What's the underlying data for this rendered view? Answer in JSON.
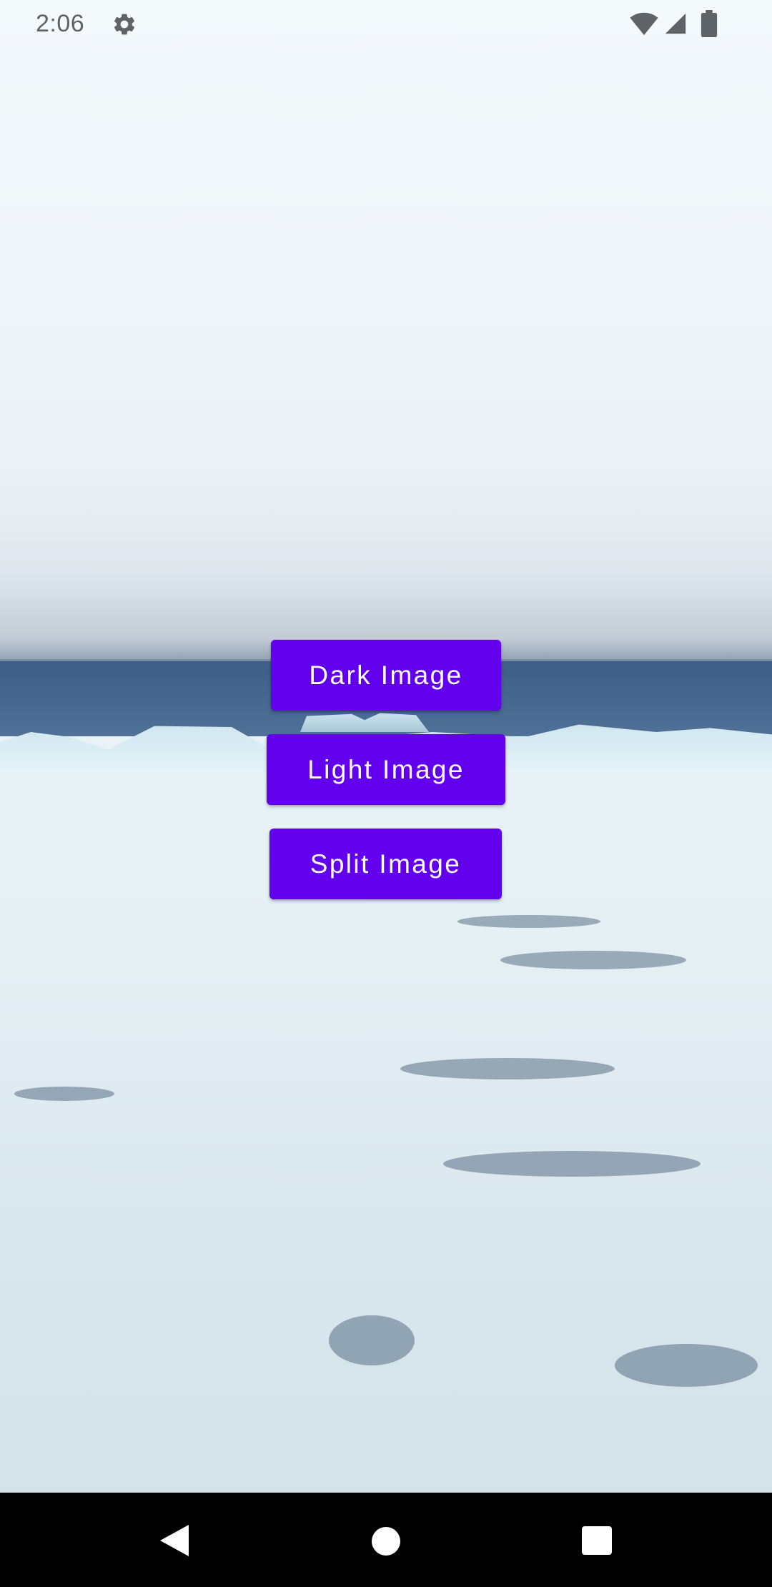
{
  "status_bar": {
    "time": "2:06",
    "icons": [
      "gear-icon",
      "wifi-icon",
      "signal-icon",
      "battery-icon"
    ]
  },
  "background": {
    "description_icon": "arctic-sea-ice-photo"
  },
  "buttons": {
    "dark_image": "Dark Image",
    "light_image": "Light Image",
    "split_image": "Split Image"
  },
  "nav_bar": {
    "icons": [
      "back-icon",
      "home-icon",
      "recents-icon"
    ]
  },
  "colors": {
    "button_background": "#6200ee",
    "button_text": "#ffffff",
    "nav_bar_background": "#000000"
  }
}
